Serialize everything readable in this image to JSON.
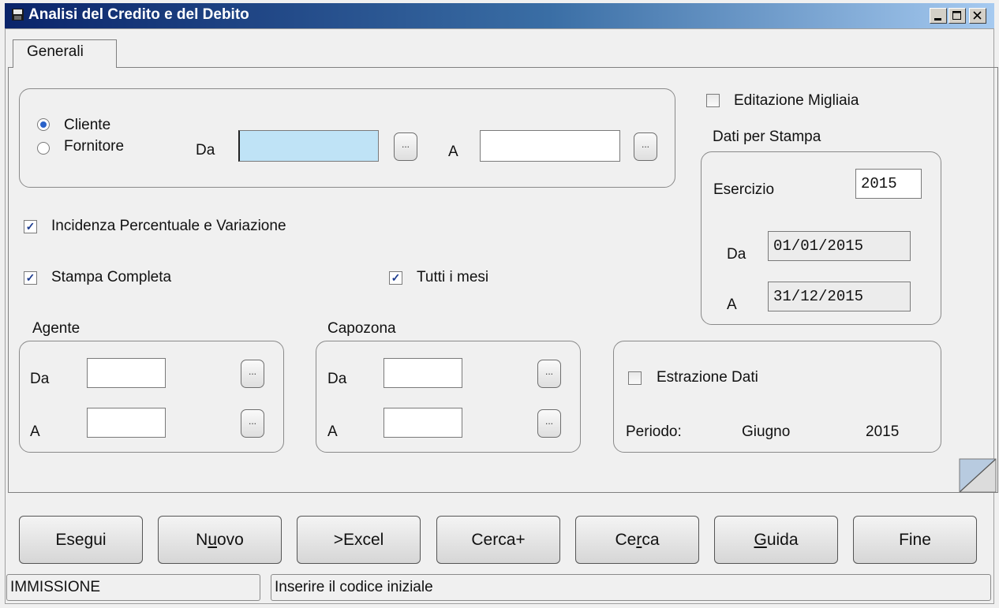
{
  "window": {
    "title": "Analisi del Credito e del Debito",
    "minimize_label": "_",
    "maximize_label": "□",
    "close_label": "×"
  },
  "tabs": [
    {
      "label": "Generali",
      "active": true
    }
  ],
  "soggetto": {
    "radio_cliente": "Cliente",
    "radio_fornitore": "Fornitore",
    "selected": "Cliente",
    "da_label": "Da",
    "da_value": "",
    "a_label": "A",
    "a_value": "",
    "lookup_label": "..."
  },
  "editazione_migliaia": {
    "label": "Editazione Migliaia",
    "checked": false
  },
  "dati_stampa": {
    "title": "Dati per Stampa",
    "esercizio_label": "Esercizio",
    "esercizio_value": "2015",
    "da_label": "Da",
    "da_value": "01/01/2015",
    "a_label": "A",
    "a_value": "31/12/2015"
  },
  "options": {
    "incidenza": {
      "label": "Incidenza Percentuale e Variazione",
      "checked": true
    },
    "stampa_completa": {
      "label": "Stampa Completa",
      "checked": true
    },
    "tutti_mesi": {
      "label": "Tutti i mesi",
      "checked": true
    },
    "check_mark": "✓"
  },
  "agente": {
    "title": "Agente",
    "da_label": "Da",
    "da_value": "",
    "a_label": "A",
    "a_value": "",
    "lookup_label": "..."
  },
  "capozona": {
    "title": "Capozona",
    "da_label": "Da",
    "da_value": "",
    "a_label": "A",
    "a_value": "",
    "lookup_label": "..."
  },
  "estrazione": {
    "label": "Estrazione Dati",
    "checked": false,
    "periodo_label": "Periodo:",
    "mese": "Giugno",
    "anno": "2015"
  },
  "buttons": {
    "esegui": "Esegui",
    "nuovo_pre": "N",
    "nuovo_u": "u",
    "nuovo_post": "ovo",
    "excel": ">Excel",
    "cerca_plus": "Cerca+",
    "cerca_pre": "Ce",
    "cerca_u": "r",
    "cerca_post": "ca",
    "guida_u": "G",
    "guida_post": "uida",
    "fine": "Fine"
  },
  "status": {
    "mode": "IMMISSIONE",
    "message": "Inserire il codice iniziale"
  },
  "colors": {
    "title_bar_start": "#0a246a",
    "title_bar_end": "#a6caf0",
    "active_field": "#bfe3f6",
    "tab_accent": "#f5b43a",
    "check_color": "#1c3b8f"
  }
}
